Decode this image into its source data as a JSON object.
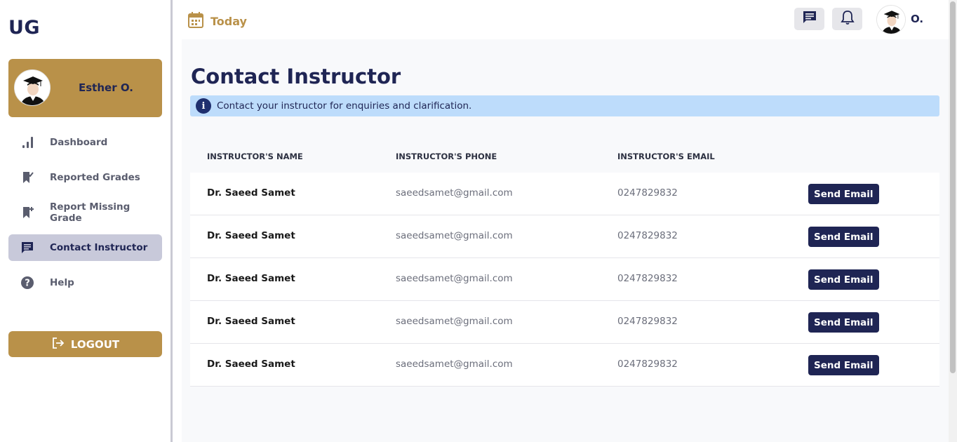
{
  "brand": "UG",
  "user": {
    "name": "Esther O.",
    "initial": "O."
  },
  "nav": [
    {
      "label": "Dashboard",
      "icon": "bar-chart-icon",
      "active": false
    },
    {
      "label": "Reported Grades",
      "icon": "bookmark-check-icon",
      "active": false
    },
    {
      "label": "Report Missing Grade",
      "icon": "bookmark-plus-icon",
      "active": false
    },
    {
      "label": "Contact Instructor",
      "icon": "chat-icon",
      "active": true
    },
    {
      "label": "Help",
      "icon": "help-circle-icon",
      "active": false
    }
  ],
  "logout_label": "LOGOUT",
  "topbar": {
    "today_label": "Today",
    "icons": [
      "calendar-icon",
      "message-icon",
      "bell-icon"
    ]
  },
  "page": {
    "title": "Contact Instructor",
    "info": "Contact your instructor for enquiries and clarification."
  },
  "table": {
    "headers": [
      "INSTRUCTOR'S NAME",
      "INSTRUCTOR'S PHONE",
      "INSTRUCTOR'S EMAIL"
    ],
    "rows": [
      {
        "name": "Dr. Saeed Samet",
        "phone": "saeedsamet@gmail.com",
        "email": "0247829832",
        "action": "Send Email"
      },
      {
        "name": "Dr. Saeed Samet",
        "phone": "saeedsamet@gmail.com",
        "email": "0247829832",
        "action": "Send Email"
      },
      {
        "name": "Dr. Saeed Samet",
        "phone": "saeedsamet@gmail.com",
        "email": "0247829832",
        "action": "Send Email"
      },
      {
        "name": "Dr. Saeed Samet",
        "phone": "saeedsamet@gmail.com",
        "email": "0247829832",
        "action": "Send Email"
      },
      {
        "name": "Dr. Saeed Samet",
        "phone": "saeedsamet@gmail.com",
        "email": "0247829832",
        "action": "Send Email"
      }
    ]
  },
  "colors": {
    "navy": "#1f2554",
    "gold": "#b99149",
    "info_bg": "#bddcfb",
    "active_nav": "#c8c9da"
  }
}
